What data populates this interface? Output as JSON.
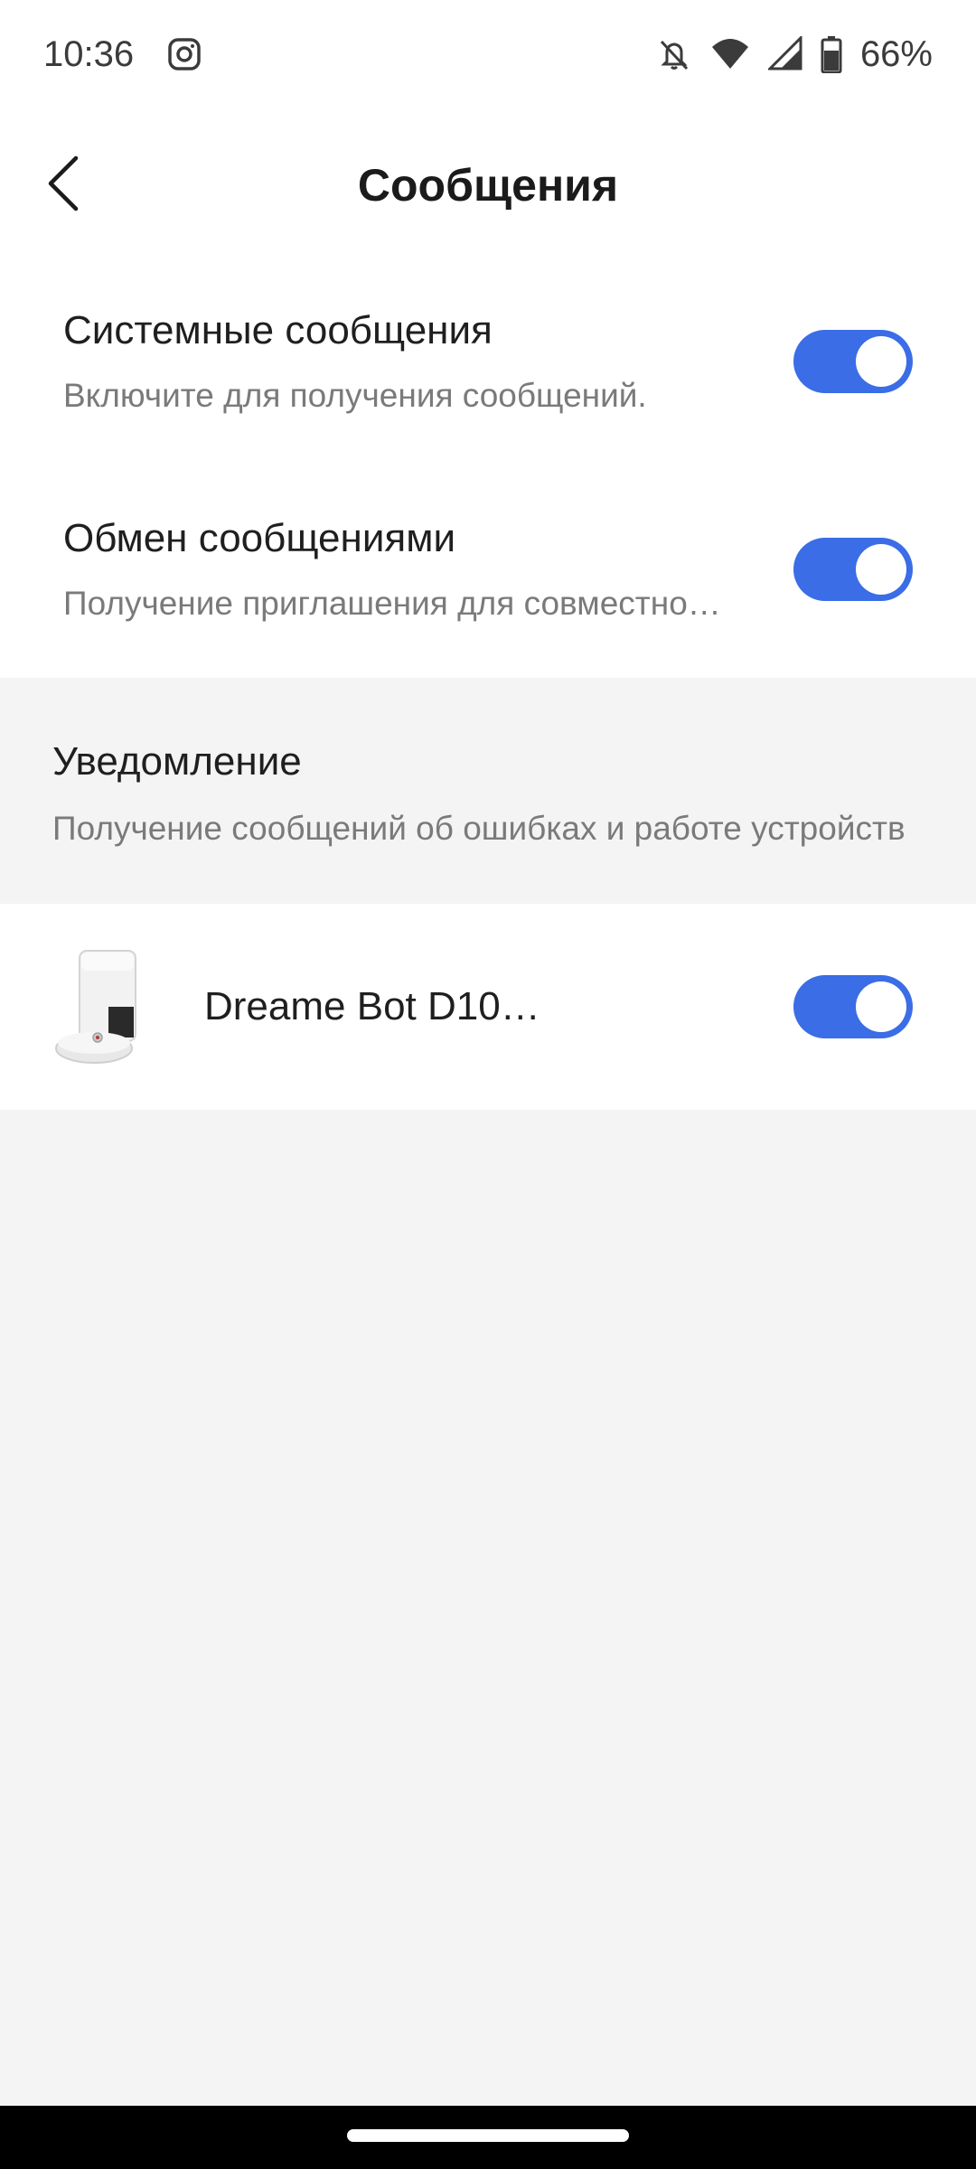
{
  "status_bar": {
    "time": "10:36",
    "battery": "66%",
    "icons": [
      "instagram-icon",
      "bell-off-icon",
      "wifi-icon",
      "signal-icon",
      "battery-icon"
    ]
  },
  "header": {
    "title": "Сообщения",
    "back_icon": "chevron-left-icon"
  },
  "settings": [
    {
      "title": "Системные сообщения",
      "description": "Включите для получения сообщений.",
      "enabled": true
    },
    {
      "title": "Обмен сообщениями",
      "description": "Получение приглашения для совместного использования устройства",
      "enabled": true
    }
  ],
  "notification": {
    "title": "Уведомление",
    "description": "Получение сообщений об ошибках и работе устройств"
  },
  "devices": [
    {
      "name": "Dream­e Bot D10…",
      "enabled": true
    }
  ],
  "colors": {
    "accent": "#3a6de6",
    "background": "#f4f4f4",
    "card": "#ffffff",
    "secondary_text": "#7a7a7a"
  }
}
